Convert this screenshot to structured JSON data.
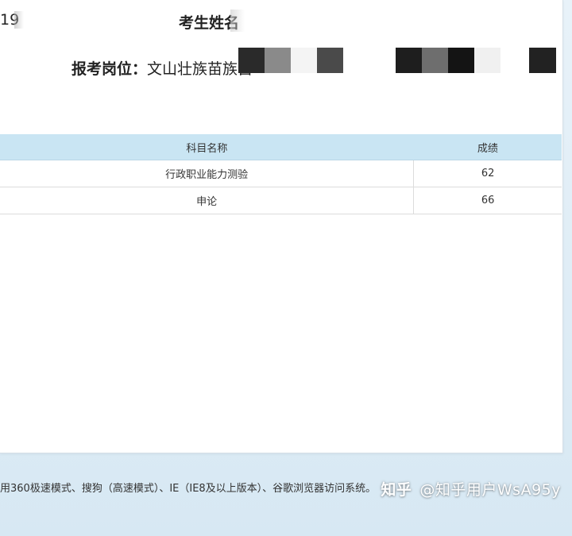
{
  "header": {
    "exam_id_partial": "19",
    "name_label": "考生姓名",
    "position_label": "报考岗位：",
    "position_value_partial": "文山壮族苗族自"
  },
  "table": {
    "columns": [
      "科目名称",
      "成绩"
    ],
    "rows": [
      {
        "subject": "行政职业能力测验",
        "score": "62"
      },
      {
        "subject": "申论",
        "score": "66"
      }
    ]
  },
  "footer": {
    "note": "用360极速模式、搜狗（高速模式）、IE（IE8及以上版本）、谷歌浏览器访问系统。"
  },
  "watermark": {
    "brand": "知乎",
    "user": "@知乎用户WsA95y"
  },
  "mosaic_colors": [
    "#2a2a2a",
    "#8a8a8a",
    "#f4f4f4",
    "#4a4a4a",
    "#ffffff",
    "#1e1e1e",
    "#6e6e6e",
    "#141414",
    "#f0f0f0",
    "#222222"
  ]
}
